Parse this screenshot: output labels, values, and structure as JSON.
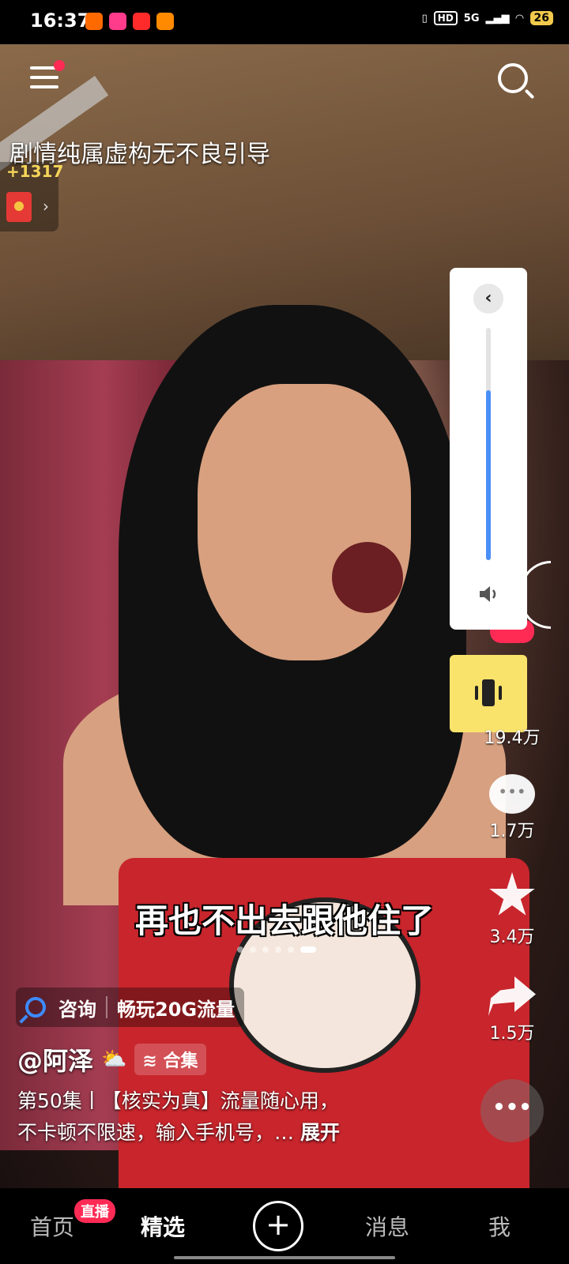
{
  "status_bar": {
    "time": "16:37",
    "app_icons": [
      "#ff6a00",
      "#ff3b8b",
      "#ff2b2b",
      "#ff8a00"
    ],
    "hd_label": "HD",
    "network": "5G",
    "battery": "26"
  },
  "top_bar": {
    "has_menu_notification": true
  },
  "overlay": {
    "disclaimer": "剧情纯属虚构无不良引导",
    "reward_count": "+1317",
    "reward_chevron": "›"
  },
  "volume": {
    "level": 0.73,
    "collapse_glyph": "‹"
  },
  "actions": {
    "likes": "19.4万",
    "comments": "1.7万",
    "favorites": "3.4万",
    "shares": "1.5万",
    "more_glyph": "•••"
  },
  "video": {
    "subtitle": "再也不出去跟他住了",
    "promo_consult": "咨询",
    "promo_offer": "畅玩20G流量",
    "author": "@阿泽",
    "weather_emoji": "⛅",
    "collection_label": "合集",
    "description_line1": "第50集丨【核实为真】流量随心用，",
    "description_line2": "不卡顿不限速，输入手机号，… ",
    "expand_label": "展开"
  },
  "tabbar": {
    "home": "首页",
    "live_badge": "直播",
    "featured": "精选",
    "post_glyph": "+",
    "messages": "消息",
    "me": "我"
  }
}
